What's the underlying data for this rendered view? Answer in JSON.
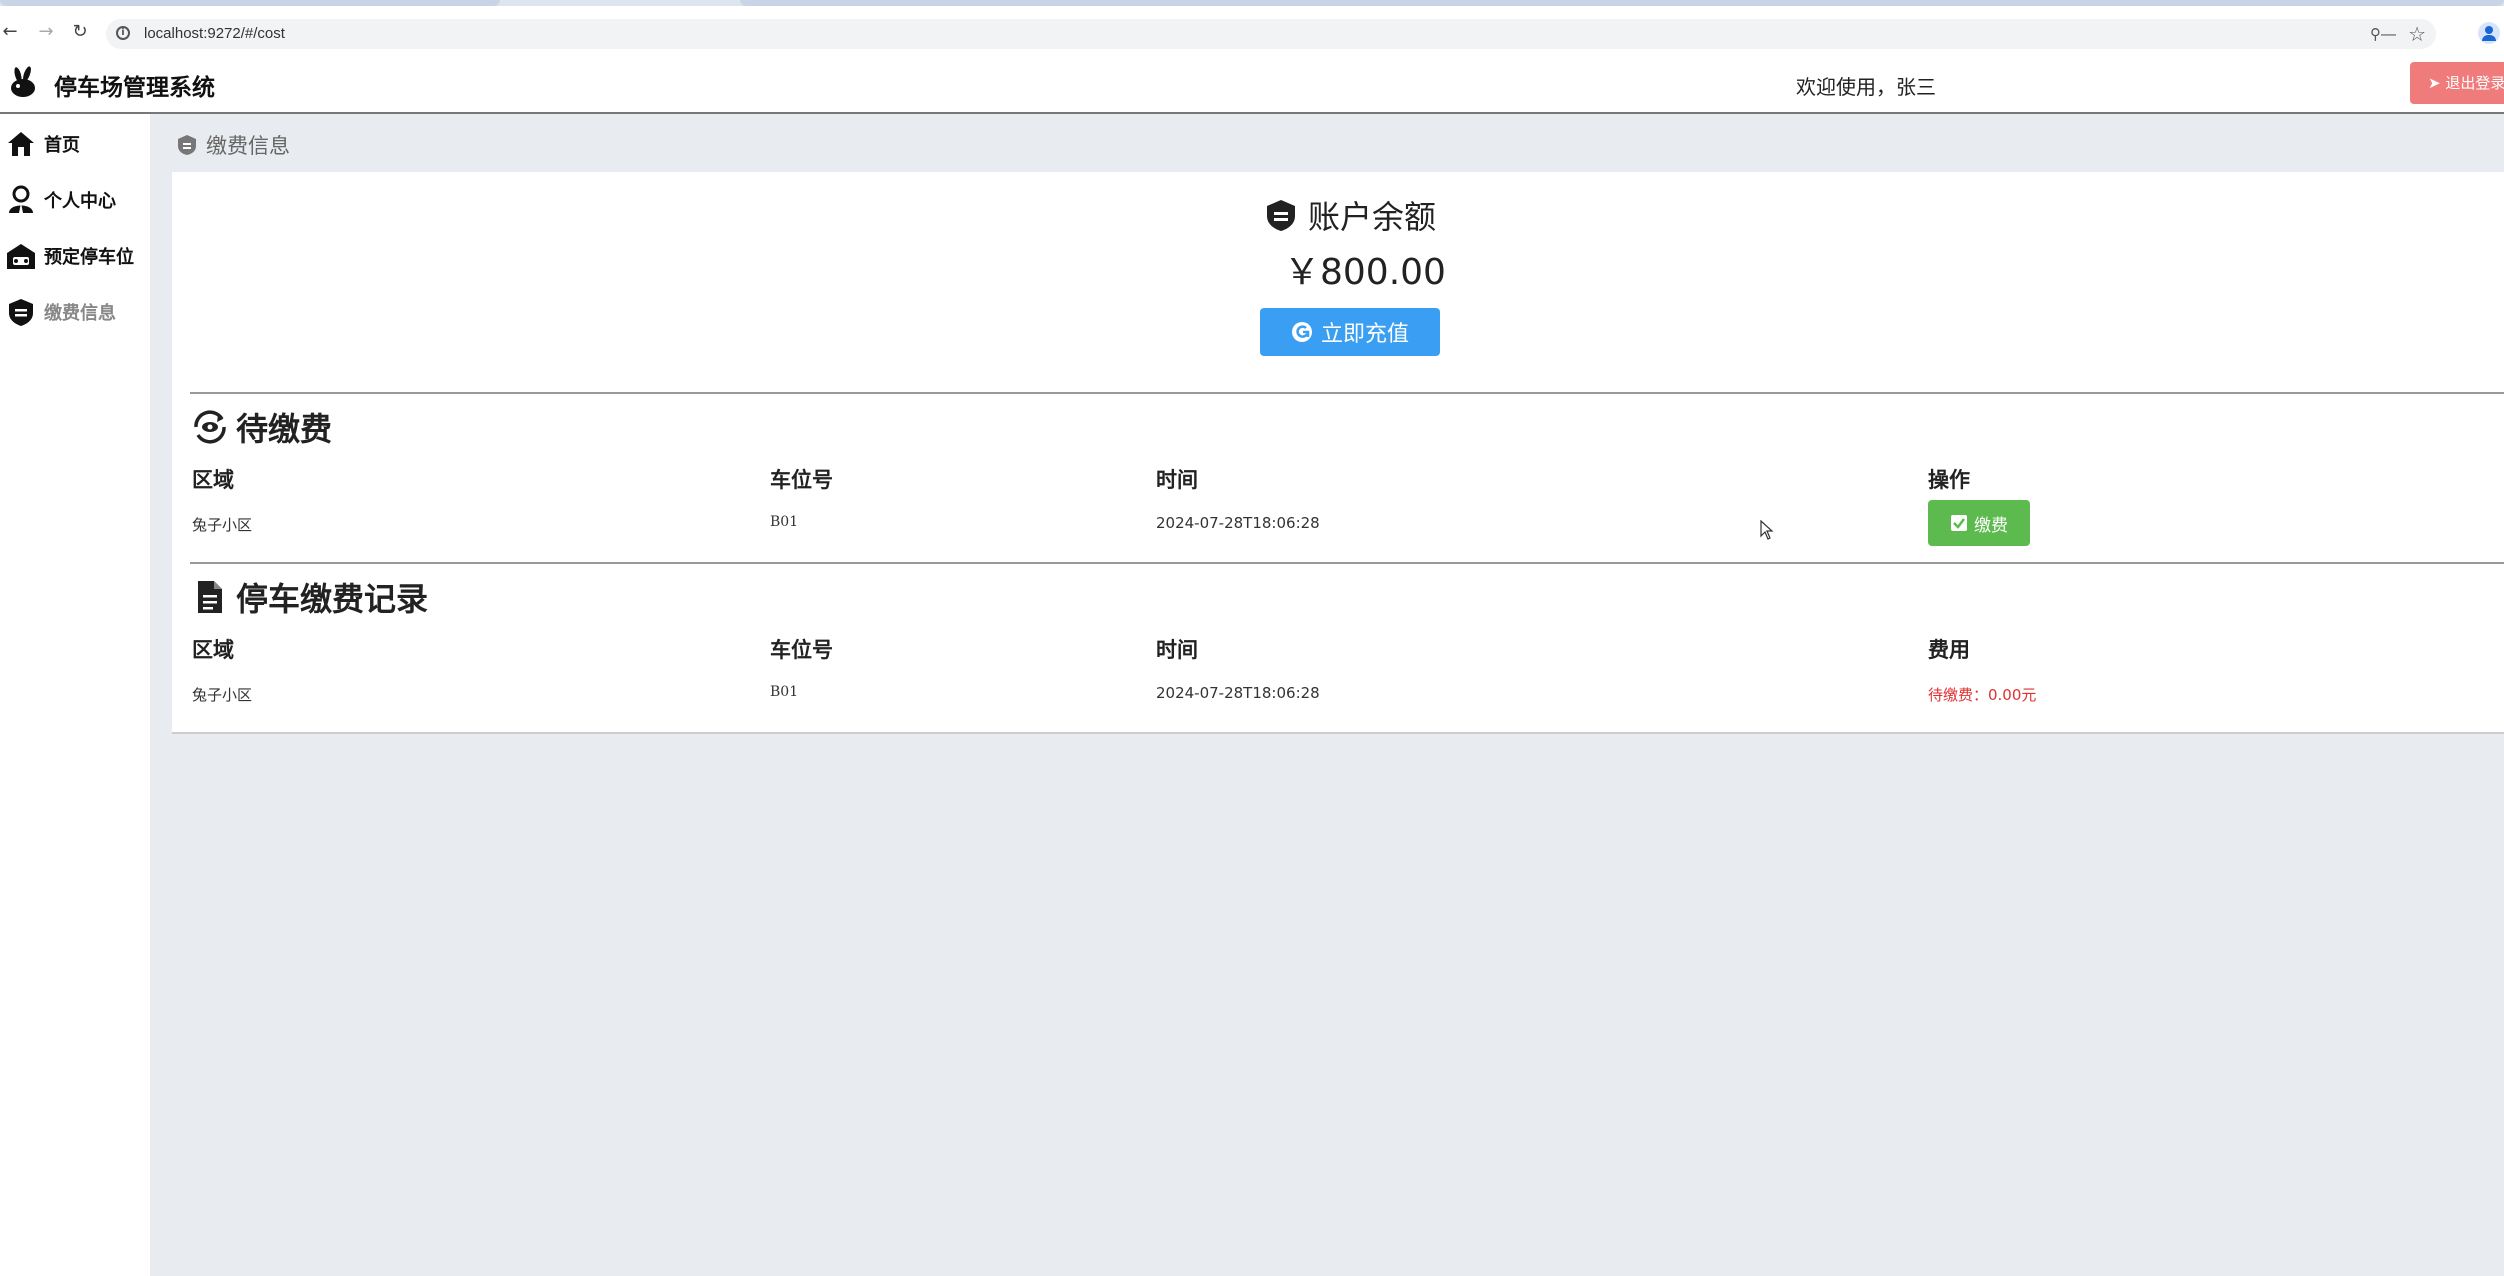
{
  "browser": {
    "url": "localhost:9272/#/cost"
  },
  "header": {
    "app_title": "停车场管理系统",
    "welcome": "欢迎使用，张三",
    "logout_label": "退出登录"
  },
  "sidebar": {
    "items": [
      {
        "label": "首页",
        "icon": "home-icon"
      },
      {
        "label": "个人中心",
        "icon": "user-icon"
      },
      {
        "label": "预定停车位",
        "icon": "parking-icon"
      },
      {
        "label": "缴费信息",
        "icon": "payment-icon"
      }
    ],
    "active_index": 3
  },
  "breadcrumb": {
    "label": "缴费信息"
  },
  "account": {
    "title": "账户余额",
    "balance": "￥800.00",
    "recharge_label": "立即充值"
  },
  "pending": {
    "title": "待缴费",
    "headers": [
      "区域",
      "车位号",
      "时间",
      "操作"
    ],
    "rows": [
      {
        "area": "兔子小区",
        "slot": "B01",
        "time": "2024-07-28T18:06:28",
        "action": "缴费"
      }
    ]
  },
  "records": {
    "title": "停车缴费记录",
    "headers": [
      "区域",
      "车位号",
      "时间",
      "费用"
    ],
    "rows": [
      {
        "area": "兔子小区",
        "slot": "B01",
        "time": "2024-07-28T18:06:28",
        "fee": "待缴费：0.00元"
      }
    ]
  },
  "colors": {
    "primary": "#3a9ff2",
    "success": "#5dba4f",
    "danger": "#f07b7b",
    "fee_text": "#e03030"
  }
}
